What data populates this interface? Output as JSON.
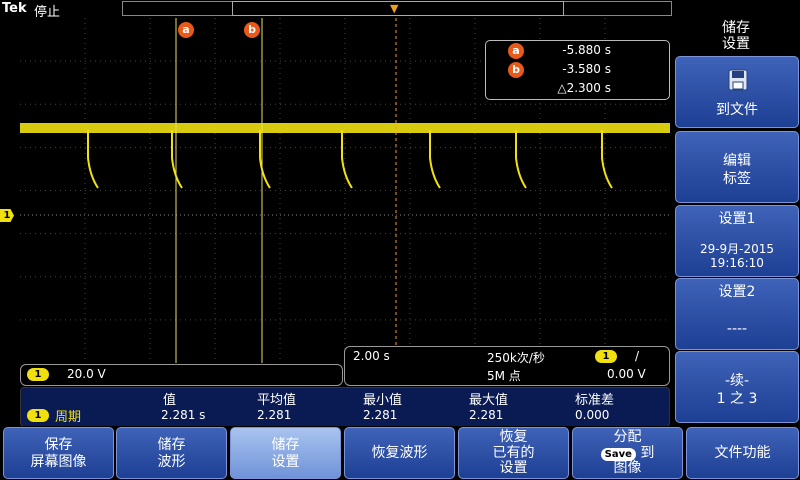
{
  "top": {
    "brand": "Tek",
    "run_state": "停止",
    "trigger_marker": "T"
  },
  "cursors": {
    "a_label": "a",
    "b_label": "b",
    "a_value": "-5.880 s",
    "b_value": "-3.580 s",
    "delta_value": "△2.300 s"
  },
  "channel": {
    "badge": "1",
    "scale": "20.0 V"
  },
  "timebase": {
    "time_per_div": "2.00 s",
    "sample_rate": "250k次/秒",
    "record_length": "5M 点",
    "trigger_badge": "1",
    "trigger_slope": "/",
    "trigger_level": "0.00 V"
  },
  "measurement": {
    "headers": [
      "值",
      "平均值",
      "最小值",
      "最大值",
      "标准差"
    ],
    "badge": "1",
    "name": "周期",
    "values": [
      "2.281 s",
      "2.281",
      "2.281",
      "2.281",
      "0.000"
    ]
  },
  "side_menu": {
    "title_line1": "储存",
    "title_line2": "设置",
    "items": [
      {
        "line1": "到文件",
        "icon": "floppy-disk-icon"
      },
      {
        "line1": "编辑",
        "line2": "标签"
      },
      {
        "line1": "设置1",
        "line2": "29-9月-2015",
        "line3": "19:16:10"
      },
      {
        "line1": "设置2",
        "line2": "----"
      },
      {
        "line1": "-续-",
        "line2": "1 之 3"
      }
    ]
  },
  "bottom_menu": [
    {
      "line1": "保存",
      "line2": "屏幕图像"
    },
    {
      "line1": "储存",
      "line2": "波形"
    },
    {
      "line1": "储存",
      "line2": "设置"
    },
    {
      "line1": "恢复波形"
    },
    {
      "line1": "恢复",
      "line2": "已有的",
      "line3": "设置"
    },
    {
      "line1": "分配",
      "pill": "Save",
      "line2": "到",
      "line3": "图像"
    },
    {
      "line1": "文件功能"
    }
  ],
  "colors": {
    "trace": "#f0e010",
    "cursor": "#e8e060",
    "menu_blue": "#1d3f94",
    "menu_selected": "#8fb0e6",
    "measurement_bg": "#0a1a52",
    "cursor_badge": "#e85a1c"
  }
}
